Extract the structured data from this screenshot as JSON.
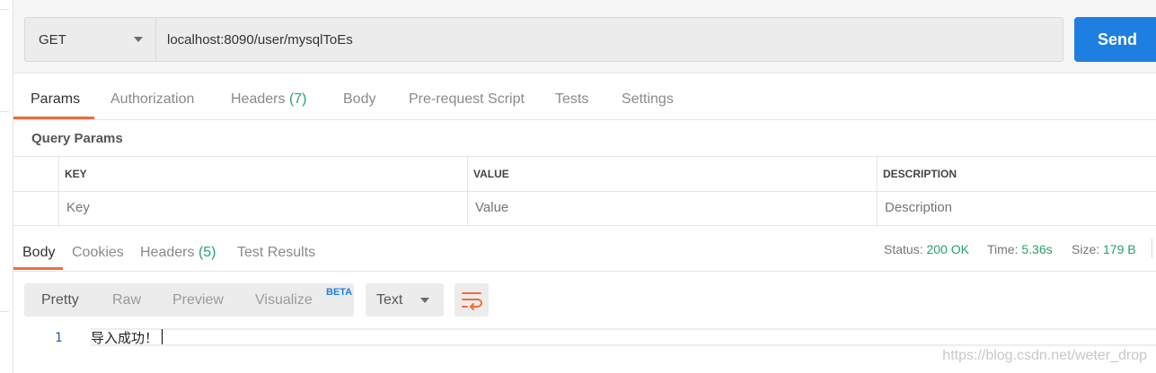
{
  "request": {
    "method": "GET",
    "url": "localhost:8090/user/mysqlToEs",
    "send_label": "Send"
  },
  "request_tabs": [
    {
      "label": "Params",
      "active": true
    },
    {
      "label": "Authorization"
    },
    {
      "label": "Headers",
      "count": "(7)"
    },
    {
      "label": "Body"
    },
    {
      "label": "Pre-request Script"
    },
    {
      "label": "Tests"
    },
    {
      "label": "Settings"
    }
  ],
  "query_params": {
    "title": "Query Params",
    "columns": [
      "KEY",
      "VALUE",
      "DESCRIPTION"
    ],
    "placeholders": [
      "Key",
      "Value",
      "Description"
    ]
  },
  "response_tabs": [
    {
      "label": "Body",
      "active": true
    },
    {
      "label": "Cookies"
    },
    {
      "label": "Headers",
      "count": "(5)"
    },
    {
      "label": "Test Results"
    }
  ],
  "status": {
    "status_label": "Status:",
    "status_value": "200 OK",
    "time_label": "Time:",
    "time_value": "5.36s",
    "size_label": "Size:",
    "size_value": "179 B"
  },
  "view_modes": [
    {
      "label": "Pretty",
      "active": true
    },
    {
      "label": "Raw"
    },
    {
      "label": "Preview"
    },
    {
      "label": "Visualize",
      "badge": "BETA"
    }
  ],
  "format": {
    "selected": "Text"
  },
  "response_body": {
    "line_number": "1",
    "text": "导入成功！"
  },
  "watermark": "https://blog.csdn.net/weter_drop",
  "colors": {
    "accent_orange": "#f26b3a",
    "send_blue": "#1f7fe0",
    "status_green": "#26a269"
  },
  "icons": [
    "chevron-down-icon",
    "wrap-lines-icon"
  ]
}
